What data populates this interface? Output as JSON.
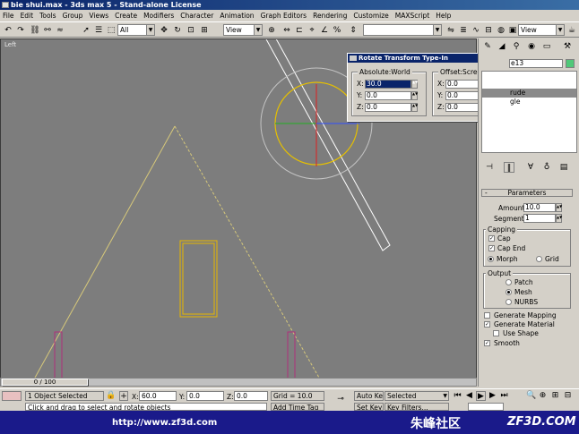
{
  "window": {
    "title": "bie shui.max - 3ds max 5 - Stand-alone License"
  },
  "menu": [
    "File",
    "Edit",
    "Tools",
    "Group",
    "Views",
    "Create",
    "Modifiers",
    "Character",
    "Animation",
    "Graph Editors",
    "Rendering",
    "Customize",
    "MAXScript",
    "Help"
  ],
  "toolbar": {
    "selection_filter": "All",
    "ref_coord": "View",
    "named_selection": "",
    "right_coord": "View"
  },
  "viewport": {
    "label": "Left"
  },
  "dialog": {
    "title": "Rotate Transform Type-In",
    "absolute_group": "Absolute:World",
    "offset_group": "Offset:Screen",
    "absolute": [
      {
        "axis": "X:",
        "value": "30.0"
      },
      {
        "axis": "Y:",
        "value": "0.0"
      },
      {
        "axis": "Z:",
        "value": "0.0"
      }
    ],
    "offset": [
      {
        "axis": "X:",
        "value": "0.0"
      },
      {
        "axis": "Y:",
        "value": "0.0"
      },
      {
        "axis": "Z:",
        "value": "0.0"
      }
    ]
  },
  "panel": {
    "object_name": "e13",
    "modifier_stack": [
      "rude",
      "gle"
    ],
    "parameters_title": "Parameters",
    "amount_label": "Amount:",
    "amount_value": "10.0",
    "segments_label": "Segments:",
    "segments_value": "1",
    "capping_title": "Capping",
    "cap_start": "Cap",
    "cap_end": "Cap End",
    "morph": "Morph",
    "grid": "Grid",
    "output_title": "Output",
    "patch": "Patch",
    "mesh": "Mesh",
    "nurbs": "NURBS",
    "gen_mapping": "Generate Mapping",
    "gen_material": "Generate Material",
    "use_shape": "Use Shape",
    "smooth": "Smooth"
  },
  "timeslider": {
    "label": "0 / 100"
  },
  "status": {
    "selection": "1 Object Selected",
    "x_label": "X:",
    "x_value": "60.0",
    "y_label": "Y:",
    "y_value": "0.0",
    "z_label": "Z:",
    "z_value": "0.0",
    "grid": "Grid = 10.0",
    "prompt": "Click and drag to select and rotate objects",
    "add_time_tag": "Add Time Tag",
    "auto_key": "Auto Key",
    "set_key": "Set Key",
    "key_mode": "Selected",
    "key_filters": "Key Filters..."
  },
  "watermark": {
    "url": "http://www.zf3d.com",
    "cn": "朱峰社区",
    "brand": "ZF3D.COM"
  }
}
